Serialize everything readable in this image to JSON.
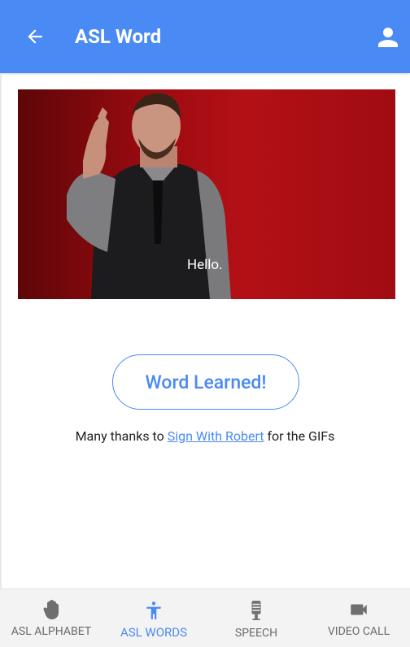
{
  "header": {
    "title": "ASL Word",
    "back_icon": "arrow-left-icon",
    "profile_icon": "person-icon",
    "bg_color": "#4a8af4"
  },
  "gif": {
    "caption": "Hello."
  },
  "actions": {
    "learned_label": "Word Learned!"
  },
  "credits": {
    "prefix": "Many thanks to",
    "link_text": "Sign With Robert",
    "suffix": "for the GIFs"
  },
  "bottom_nav": {
    "items": [
      {
        "label": "ASL ALPHABET",
        "icon": "hand-icon",
        "active": false
      },
      {
        "label": "ASL WORDS",
        "icon": "person-standing-icon",
        "active": true
      },
      {
        "label": "SPEECH",
        "icon": "microphone-icon",
        "active": false
      },
      {
        "label": "VIDEO CALL",
        "icon": "videocam-icon",
        "active": false
      }
    ],
    "active_color": "#4a8af4"
  }
}
